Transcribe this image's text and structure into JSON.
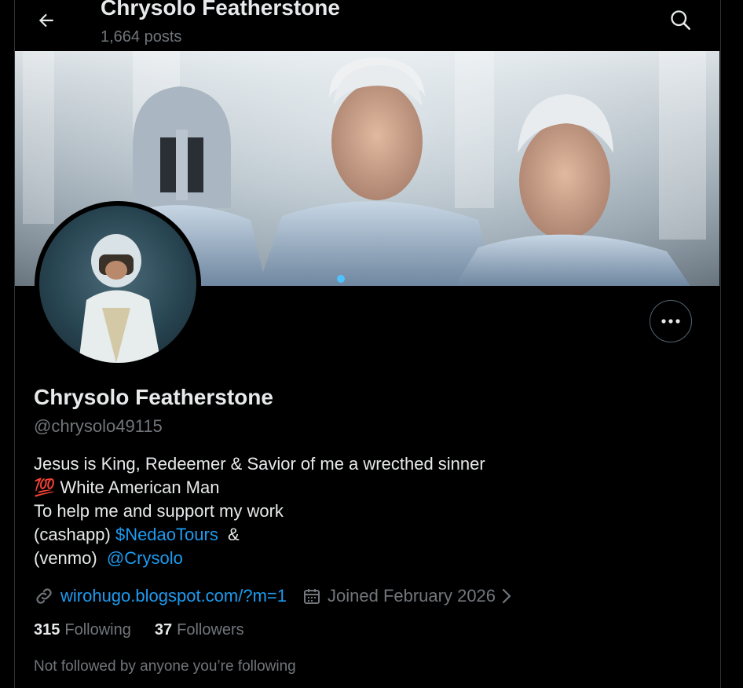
{
  "header": {
    "title": "Chrysolo Featherstone",
    "post_count": "1,664 posts"
  },
  "profile": {
    "display_name": "Chrysolo Featherstone",
    "handle": "@chrysolo49115",
    "bio": {
      "line1": "Jesus is King, Redeemer & Savior of me a wrecthed sinner",
      "line2_emoji": "💯",
      "line2_text": " White American Man",
      "line3": "To help me and support my work",
      "line4_prefix": "(cashapp) ",
      "line4_link": "$NedaoTours",
      "line4_suffix": "  &",
      "line5_prefix": "(venmo)  ",
      "line5_link": "@Crysolo"
    },
    "website": "wirohugo.blogspot.com/?m=1",
    "joined": "Joined February 2026",
    "following_count": "315",
    "following_label": "Following",
    "followers_count": "37",
    "followers_label": "Followers",
    "not_followed_text": "Not followed by anyone you’re following"
  },
  "icons": {
    "back": "arrow-left-icon",
    "search": "search-icon",
    "more": "more-horizontal-icon",
    "link": "link-icon",
    "calendar": "calendar-icon",
    "chevron": "chevron-right-icon"
  },
  "colors": {
    "background": "#000000",
    "text_primary": "#e7e9ea",
    "text_secondary": "#71767b",
    "accent": "#1d9bf0",
    "border": "#2f3336"
  }
}
